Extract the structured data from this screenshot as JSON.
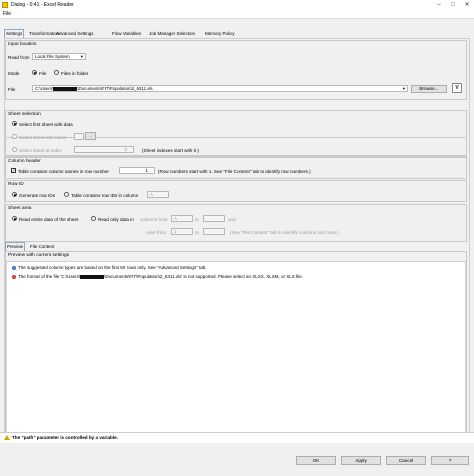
{
  "window": {
    "title": "Dialog - 0:41 - Excel Reader"
  },
  "menu": {
    "file": "File"
  },
  "tabs": [
    "Settings",
    "Transformation",
    "Advanced Settings",
    "Flow Variables",
    "Job Manager Selection",
    "Memory Policy"
  ],
  "input_location": {
    "label": "Input location",
    "read_from_label": "Read from",
    "read_from_value": "Local File System",
    "mode_label": "Mode",
    "mode_file": "File",
    "mode_folder": "Files in folder",
    "file_label": "File",
    "path_prefix": "C:\\Users\\",
    "path_suffix": "\\Documents\\FIT\\Population\\2_6311.xls",
    "browse": "Browse...",
    "var_icon": "V"
  },
  "sheet_selection": {
    "label": "Sheet selection",
    "first_sheet": "Select first sheet with data",
    "sheet_with_name": "Select sheet with name",
    "sheet_at_index": "Select sheet at index",
    "index_value": "0",
    "index_hint": "(Sheet indexes start with 0.)",
    "name_btn": "..."
  },
  "column_header": {
    "label": "Column header",
    "contains_names": "Table contains column names in row number",
    "row_value": "1",
    "hint": "(Row numbers start with 1. See \"File Content\" tab to identify row numbers.)"
  },
  "row_id": {
    "label": "Row ID",
    "generate": "Generate row IDs",
    "contains": "Table contains row IDs in column",
    "column_value": "A"
  },
  "sheet_area": {
    "label": "Sheet area",
    "entire": "Read entire data of the sheet",
    "only": "Read only data in",
    "columns_from": "columns from",
    "col_from": "A",
    "to": "to",
    "and": "and",
    "rows_from": "rows from",
    "row_from": "1",
    "hint": "(See \"File Content\" tab to identify columns and rows.)"
  },
  "preview_tabs": [
    "Preview",
    "File Content"
  ],
  "preview": {
    "label": "Preview with current settings",
    "info_msg": "The suggested column types are based on the first 50 rows only. See \"Advanced Settings\" tab.",
    "error_prefix": "The format of the file 'C:\\Users\\",
    "error_suffix": "\\Documents\\FIT\\Population\\2_6311.xls' is not supported. Please select an XLSX, XLSM, or XLS file."
  },
  "status": "The \"path\" parameter is controlled by a variable.",
  "buttons": {
    "ok": "OK",
    "apply": "Apply",
    "cancel": "Cancel",
    "help": "?"
  },
  "colors": {
    "info": "#3c6fbf",
    "error": "#d32f2f",
    "warning": "#e0a000"
  }
}
